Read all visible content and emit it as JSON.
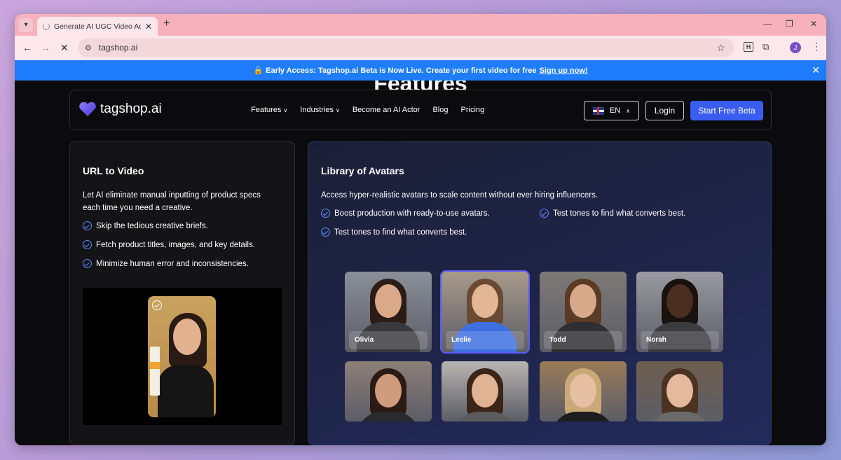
{
  "browser": {
    "tab_title": "Generate AI UGC Video Ads in S",
    "url": "tagshop.ai",
    "profile_initial": "J",
    "extension_label": "H"
  },
  "banner": {
    "emoji": "🔓",
    "text": "Early Access: Tagshop.ai Beta is Now Live. Create your first video for free",
    "link": "Sign up now!"
  },
  "page": {
    "section_heading": "Features"
  },
  "nav": {
    "brand": "tagshop.ai",
    "links": [
      {
        "label": "Features",
        "dropdown": true
      },
      {
        "label": "Industries",
        "dropdown": true
      },
      {
        "label": "Become an AI Actor",
        "dropdown": false
      },
      {
        "label": "Blog",
        "dropdown": false
      },
      {
        "label": "Pricing",
        "dropdown": false
      }
    ],
    "language": "EN",
    "login": "Login",
    "cta": "Start Free Beta"
  },
  "url_card": {
    "title": "URL to Video",
    "description": "Let AI eliminate manual inputting of product specs each time you need a creative.",
    "bullets": [
      "Skip the tedious creative briefs.",
      "Fetch product titles, images, and key details.",
      "Minimize human error and inconsistencies."
    ]
  },
  "avatar_card": {
    "title": "Library of Avatars",
    "description": "Access hyper-realistic avatars to scale content without ever hiring influencers.",
    "bullets": [
      "Boost production with ready-to-use avatars.",
      "Test tones to find what converts best.",
      "Test tones to find what converts best."
    ],
    "avatars": [
      {
        "name": "Olivia",
        "selected": false,
        "bg": "#8a8f98",
        "skin": "#d9a98a",
        "hair": "#2b1d16",
        "top": "#3a3a3e"
      },
      {
        "name": "Leslie",
        "selected": true,
        "bg": "#a89b8a",
        "skin": "#e3b796",
        "hair": "#6b4a33",
        "top": "#3d6fe0"
      },
      {
        "name": "Todd",
        "selected": false,
        "bg": "#7d7a77",
        "skin": "#d8a88a",
        "hair": "#5a3b26",
        "top": "#2f2f33"
      },
      {
        "name": "Norah",
        "selected": false,
        "bg": "#9a9aa0",
        "skin": "#4a2e22",
        "hair": "#1a120e",
        "top": "#3b3b40"
      },
      {
        "name": "",
        "selected": false,
        "bg": "#8d7f79",
        "skin": "#cf9c7e",
        "hair": "#2b1b14",
        "top": "#2a2a2e"
      },
      {
        "name": "",
        "selected": false,
        "bg": "#b9b5b1",
        "skin": "#e0b394",
        "hair": "#3a2518",
        "top": "#5a5a5f"
      },
      {
        "name": "",
        "selected": false,
        "bg": "#9a7b58",
        "skin": "#e6c0a2",
        "hair": "#c9a978",
        "top": "#1d1d20"
      },
      {
        "name": "",
        "selected": false,
        "bg": "#6e5e50",
        "skin": "#e4b99c",
        "hair": "#4a3323",
        "top": "#6b6a68"
      }
    ]
  }
}
